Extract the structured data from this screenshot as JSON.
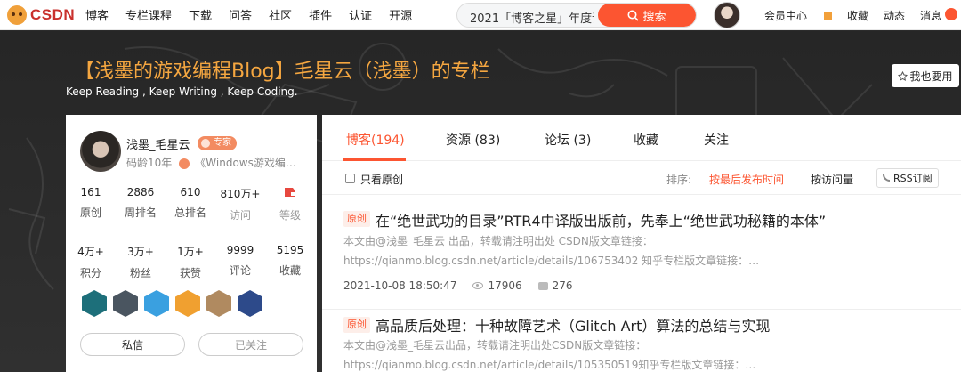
{
  "topbar": {
    "logo": "CSDN",
    "nav": [
      "博客",
      "专栏课程",
      "下载",
      "问答",
      "社区",
      "插件",
      "认证",
      "开源"
    ],
    "search_value": "2021「博客之星」年度评",
    "search_button": "搜索",
    "right_nav": [
      "会员中心",
      "收藏",
      "动态",
      "消息"
    ]
  },
  "banner": {
    "title": "【浅墨的游戏编程Blog】毛星云（浅墨）的专栏",
    "subtitle": "Keep Reading , Keep Writing , Keep Coding.",
    "use_button": "我也要用"
  },
  "profile": {
    "name": "浅墨_毛星云",
    "tag": "专家",
    "years": "码龄10年",
    "column": "《Windows游戏编…",
    "stats_row1": [
      {
        "value": "161",
        "label": "原创"
      },
      {
        "value": "2886",
        "label": "周排名"
      },
      {
        "value": "610",
        "label": "总排名"
      },
      {
        "value": "810万+",
        "label": "访问"
      },
      {
        "value": "",
        "label": "等级"
      }
    ],
    "stats_row2": [
      {
        "value": "4万+",
        "label": "积分"
      },
      {
        "value": "3万+",
        "label": "粉丝"
      },
      {
        "value": "1万+",
        "label": "获赞"
      },
      {
        "value": "9999",
        "label": "评论"
      },
      {
        "value": "5195",
        "label": "收藏"
      }
    ],
    "medal_colors": [
      "#1d6f7a",
      "#4a5560",
      "#3aa0e0",
      "#f0a030",
      "#b08a60",
      "#2d4a8a"
    ],
    "message_button": "私信",
    "followed_button": "已关注"
  },
  "tabs": [
    {
      "label": "博客(194)"
    },
    {
      "label": "资源 (83)"
    },
    {
      "label": "论坛 (3)"
    },
    {
      "label": "收藏"
    },
    {
      "label": "关注"
    }
  ],
  "filter": {
    "only_original": "只看原创",
    "sort_label": "排序:",
    "latest": "按最后发布时间",
    "views": "按访问量",
    "rss": "RSS订阅"
  },
  "articles": [
    {
      "tag": "原创",
      "title": "在“绝世武功的目录”RTR4中译版出版前，先奉上“绝世武功秘籍的本体”",
      "desc1": "本文由@浅墨_毛星云 出品，转载请注明出处 CSDN版文章链接：",
      "desc2": "https://qianmo.blog.csdn.net/article/details/106753402 知乎专栏版文章链接：…",
      "date": "2021-10-08 18:50:47",
      "views": "17906",
      "comments": "276"
    },
    {
      "tag": "原创",
      "title": "高品质后处理：十种故障艺术（Glitch Art）算法的总结与实现",
      "desc1": "本文由@浅墨_毛星云出品，转载请注明出处CSDN版文章链接：",
      "desc2": "https://qianmo.blog.csdn.net/article/details/105350519知乎专栏版文章链接：…"
    }
  ]
}
